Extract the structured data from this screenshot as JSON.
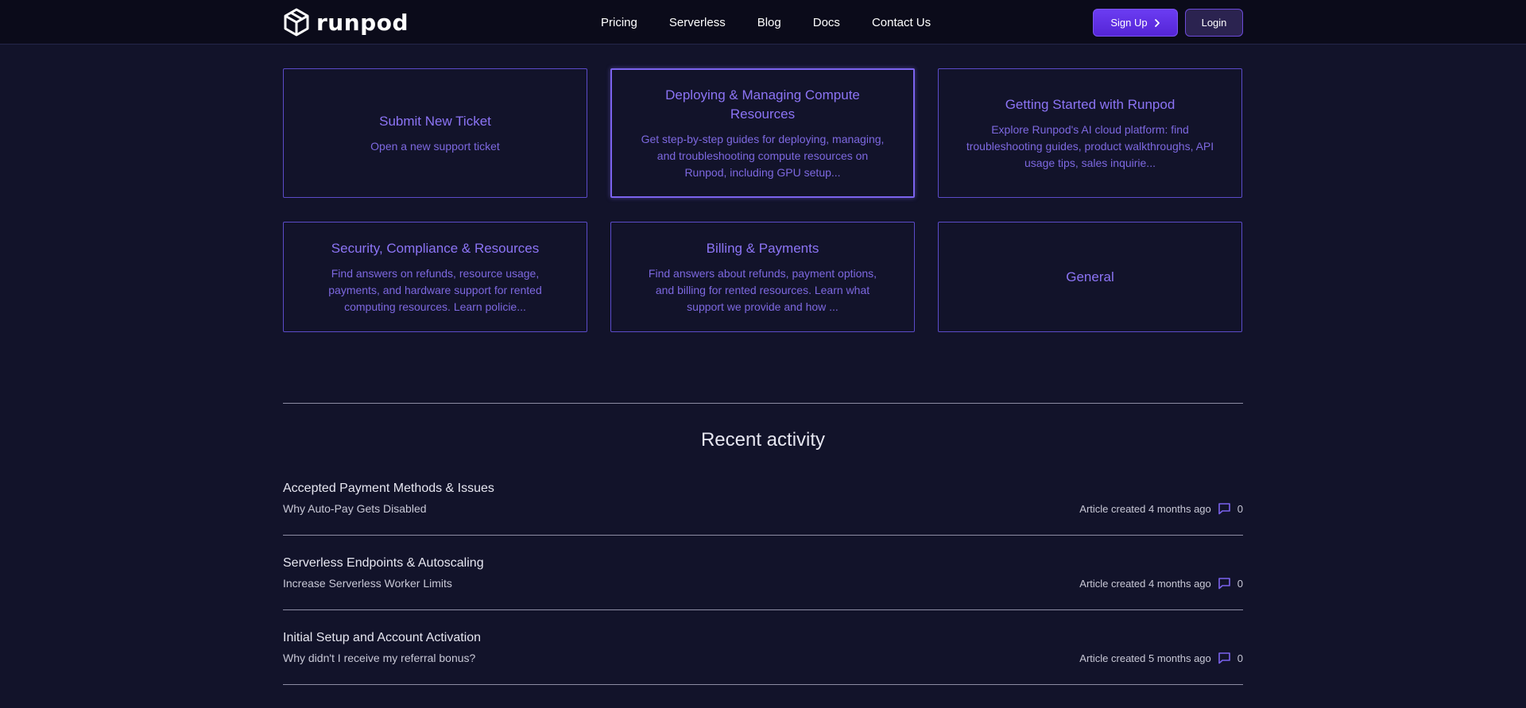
{
  "header": {
    "logo_text": "runpod",
    "logo_icon": "cube-icon",
    "nav": [
      "Pricing",
      "Serverless",
      "Blog",
      "Docs",
      "Contact Us"
    ],
    "signup_label": "Sign Up",
    "login_label": "Login"
  },
  "cards": [
    {
      "title": "Submit New Ticket",
      "desc": "Open a new support ticket"
    },
    {
      "title": "Deploying & Managing Compute Resources",
      "desc": "Get step-by-step guides for deploying, managing, and troubleshooting compute resources on Runpod, including GPU setup..."
    },
    {
      "title": "Getting Started with Runpod",
      "desc": "Explore Runpod's AI cloud platform: find troubleshooting guides, product walkthroughs, API usage tips, sales inquirie..."
    },
    {
      "title": "Security, Compliance & Resources",
      "desc": "Find answers on refunds, resource usage, payments, and hardware support for rented computing resources. Learn policie..."
    },
    {
      "title": "Billing & Payments",
      "desc": "Find answers about refunds, payment options, and billing for rented resources. Learn what support we provide and how ..."
    },
    {
      "title": "General",
      "desc": ""
    }
  ],
  "recent": {
    "title": "Recent activity",
    "items": [
      {
        "category": "Accepted Payment Methods & Issues",
        "title": "Why Auto-Pay Gets Disabled",
        "meta": "Article created 4 months ago",
        "comments": "0"
      },
      {
        "category": "Serverless Endpoints & Autoscaling",
        "title": "Increase Serverless Worker Limits",
        "meta": "Article created 4 months ago",
        "comments": "0"
      },
      {
        "category": "Initial Setup and Account Activation",
        "title": "Why didn't I receive my referral bonus?",
        "meta": "Article created 5 months ago",
        "comments": "0"
      }
    ]
  },
  "colors": {
    "background": "#12132a",
    "header": "#0b0b1a",
    "accent": "#8c74f5",
    "button": "#5b2ee0"
  }
}
